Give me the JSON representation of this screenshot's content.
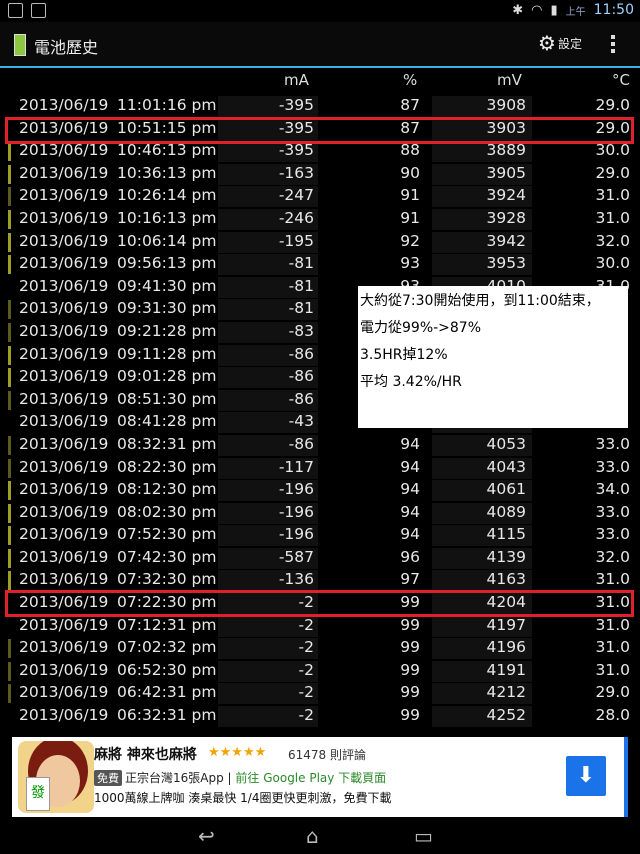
{
  "status": {
    "ampm": "上午",
    "time": "11:50"
  },
  "app": {
    "title": "電池歷史",
    "settings_label": "設定"
  },
  "header": {
    "ma": "mA",
    "pct": "%",
    "mv": "mV",
    "c": "°C"
  },
  "colors": {
    "accent": "#33b5e5",
    "highlight": "#e0202a",
    "bar_green": "#9e9d24",
    "bar_dark": "#5a5a1a"
  },
  "rows": [
    {
      "date": "2013/06/19",
      "time": "11:01:16 pm",
      "ma": "-395",
      "pct": "87",
      "mv": "3908",
      "c": "29.0",
      "bar": "none"
    },
    {
      "date": "2013/06/19",
      "time": "10:51:15 pm",
      "ma": "-395",
      "pct": "87",
      "mv": "3903",
      "c": "29.0",
      "bar": "none"
    },
    {
      "date": "2013/06/19",
      "time": "10:46:13 pm",
      "ma": "-395",
      "pct": "88",
      "mv": "3889",
      "c": "30.0",
      "bar": "green"
    },
    {
      "date": "2013/06/19",
      "time": "10:36:13 pm",
      "ma": "-163",
      "pct": "90",
      "mv": "3905",
      "c": "29.0",
      "bar": "green"
    },
    {
      "date": "2013/06/19",
      "time": "10:26:14 pm",
      "ma": "-247",
      "pct": "91",
      "mv": "3924",
      "c": "31.0",
      "bar": "dark"
    },
    {
      "date": "2013/06/19",
      "time": "10:16:13 pm",
      "ma": "-246",
      "pct": "91",
      "mv": "3928",
      "c": "31.0",
      "bar": "green"
    },
    {
      "date": "2013/06/19",
      "time": "10:06:14 pm",
      "ma": "-195",
      "pct": "92",
      "mv": "3942",
      "c": "32.0",
      "bar": "green"
    },
    {
      "date": "2013/06/19",
      "time": "09:56:13 pm",
      "ma": "-81",
      "pct": "93",
      "mv": "3953",
      "c": "30.0",
      "bar": "green"
    },
    {
      "date": "2013/06/19",
      "time": "09:41:30 pm",
      "ma": "-81",
      "pct": "93",
      "mv": "4010",
      "c": "31.0",
      "bar": "none"
    },
    {
      "date": "2013/06/19",
      "time": "09:31:30 pm",
      "ma": "-81",
      "pct": "",
      "mv": "",
      "c": "",
      "bar": "dark"
    },
    {
      "date": "2013/06/19",
      "time": "09:21:28 pm",
      "ma": "-83",
      "pct": "",
      "mv": "",
      "c": "",
      "bar": "dark"
    },
    {
      "date": "2013/06/19",
      "time": "09:11:28 pm",
      "ma": "-86",
      "pct": "",
      "mv": "",
      "c": "",
      "bar": "green"
    },
    {
      "date": "2013/06/19",
      "time": "09:01:28 pm",
      "ma": "-86",
      "pct": "",
      "mv": "",
      "c": "",
      "bar": "green"
    },
    {
      "date": "2013/06/19",
      "time": "08:51:30 pm",
      "ma": "-86",
      "pct": "",
      "mv": "",
      "c": "",
      "bar": "dark"
    },
    {
      "date": "2013/06/19",
      "time": "08:41:28 pm",
      "ma": "-43",
      "pct": "",
      "mv": "",
      "c": "",
      "bar": "none"
    },
    {
      "date": "2013/06/19",
      "time": "08:32:31 pm",
      "ma": "-86",
      "pct": "94",
      "mv": "4053",
      "c": "33.0",
      "bar": "dark"
    },
    {
      "date": "2013/06/19",
      "time": "08:22:30 pm",
      "ma": "-117",
      "pct": "94",
      "mv": "4043",
      "c": "33.0",
      "bar": "dark"
    },
    {
      "date": "2013/06/19",
      "time": "08:12:30 pm",
      "ma": "-196",
      "pct": "94",
      "mv": "4061",
      "c": "34.0",
      "bar": "green"
    },
    {
      "date": "2013/06/19",
      "time": "08:02:30 pm",
      "ma": "-196",
      "pct": "94",
      "mv": "4089",
      "c": "33.0",
      "bar": "green"
    },
    {
      "date": "2013/06/19",
      "time": "07:52:30 pm",
      "ma": "-196",
      "pct": "94",
      "mv": "4115",
      "c": "33.0",
      "bar": "green"
    },
    {
      "date": "2013/06/19",
      "time": "07:42:30 pm",
      "ma": "-587",
      "pct": "96",
      "mv": "4139",
      "c": "32.0",
      "bar": "green"
    },
    {
      "date": "2013/06/19",
      "time": "07:32:30 pm",
      "ma": "-136",
      "pct": "97",
      "mv": "4163",
      "c": "31.0",
      "bar": "green"
    },
    {
      "date": "2013/06/19",
      "time": "07:22:30 pm",
      "ma": "-2",
      "pct": "99",
      "mv": "4204",
      "c": "31.0",
      "bar": "none"
    },
    {
      "date": "2013/06/19",
      "time": "07:12:31 pm",
      "ma": "-2",
      "pct": "99",
      "mv": "4197",
      "c": "31.0",
      "bar": "none"
    },
    {
      "date": "2013/06/19",
      "time": "07:02:32 pm",
      "ma": "-2",
      "pct": "99",
      "mv": "4196",
      "c": "31.0",
      "bar": "dark"
    },
    {
      "date": "2013/06/19",
      "time": "06:52:30 pm",
      "ma": "-2",
      "pct": "99",
      "mv": "4191",
      "c": "31.0",
      "bar": "dark"
    },
    {
      "date": "2013/06/19",
      "time": "06:42:31 pm",
      "ma": "-2",
      "pct": "99",
      "mv": "4212",
      "c": "29.0",
      "bar": "dark"
    },
    {
      "date": "2013/06/19",
      "time": "06:32:31 pm",
      "ma": "-2",
      "pct": "99",
      "mv": "4252",
      "c": "28.0",
      "bar": "none"
    }
  ],
  "note": {
    "line1": "大約從7:30開始使用，到11:00結束，",
    "line2": "電力從99%->87%",
    "line3": "3.5HR掉12%",
    "line4": "平均 3.42%/HR"
  },
  "ad": {
    "name": "麻將 神來也麻將",
    "stars": "★★★★★",
    "rating": "61478 則評論",
    "free": "免費",
    "line2": "正宗台灣16張App",
    "link": "前往 Google Play 下載頁面",
    "line3": "1000萬線上牌咖 湊桌最快 1/4圈更快更刺激，免費下載",
    "tile": "發"
  }
}
